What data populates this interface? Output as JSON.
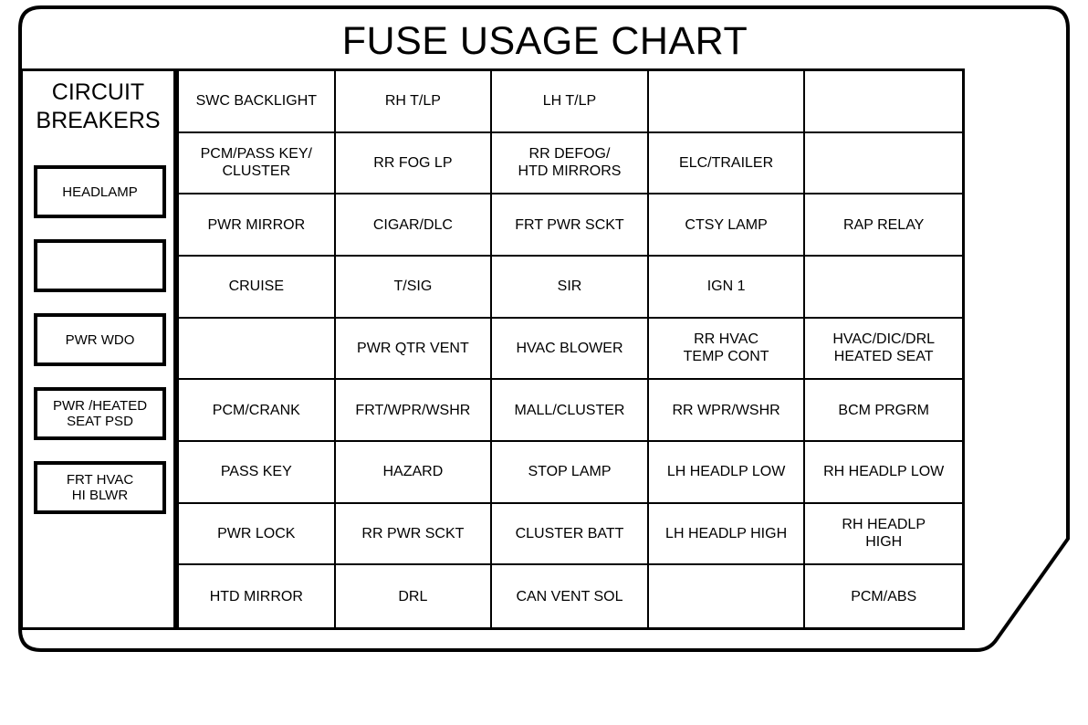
{
  "title": "FUSE USAGE CHART",
  "breakers": {
    "heading_line1": "CIRCUIT",
    "heading_line2": "BREAKERS",
    "items": [
      {
        "line1": "HEADLAMP",
        "line2": ""
      },
      {
        "line1": "",
        "line2": ""
      },
      {
        "line1": "PWR WDO",
        "line2": ""
      },
      {
        "line1": "PWR /HEATED",
        "line2": "SEAT PSD"
      },
      {
        "line1": "FRT HVAC",
        "line2": "HI BLWR"
      }
    ]
  },
  "grid": {
    "columns": 5,
    "rows": 9,
    "cells": [
      [
        {
          "line1": "SWC BACKLIGHT",
          "line2": ""
        },
        {
          "line1": "RH T/LP",
          "line2": ""
        },
        {
          "line1": "LH T/LP",
          "line2": ""
        },
        {
          "line1": "",
          "line2": ""
        },
        {
          "line1": "",
          "line2": ""
        }
      ],
      [
        {
          "line1": "PCM/PASS KEY/",
          "line2": "CLUSTER"
        },
        {
          "line1": "RR FOG LP",
          "line2": ""
        },
        {
          "line1": "RR DEFOG/",
          "line2": "HTD MIRRORS"
        },
        {
          "line1": "ELC/TRAILER",
          "line2": ""
        },
        {
          "line1": "",
          "line2": ""
        }
      ],
      [
        {
          "line1": "PWR MIRROR",
          "line2": ""
        },
        {
          "line1": "CIGAR/DLC",
          "line2": ""
        },
        {
          "line1": "FRT PWR SCKT",
          "line2": ""
        },
        {
          "line1": "CTSY LAMP",
          "line2": ""
        },
        {
          "line1": "RAP RELAY",
          "line2": ""
        }
      ],
      [
        {
          "line1": "CRUISE",
          "line2": ""
        },
        {
          "line1": "T/SIG",
          "line2": ""
        },
        {
          "line1": "SIR",
          "line2": ""
        },
        {
          "line1": "IGN 1",
          "line2": ""
        },
        {
          "line1": "",
          "line2": ""
        }
      ],
      [
        {
          "line1": "",
          "line2": ""
        },
        {
          "line1": "PWR QTR VENT",
          "line2": ""
        },
        {
          "line1": "HVAC BLOWER",
          "line2": ""
        },
        {
          "line1": "RR HVAC",
          "line2": "TEMP CONT"
        },
        {
          "line1": "HVAC/DIC/DRL",
          "line2": "HEATED SEAT"
        }
      ],
      [
        {
          "line1": "PCM/CRANK",
          "line2": ""
        },
        {
          "line1": "FRT/WPR/WSHR",
          "line2": ""
        },
        {
          "line1": "MALL/CLUSTER",
          "line2": ""
        },
        {
          "line1": "RR WPR/WSHR",
          "line2": ""
        },
        {
          "line1": "BCM PRGRM",
          "line2": ""
        }
      ],
      [
        {
          "line1": "PASS KEY",
          "line2": ""
        },
        {
          "line1": "HAZARD",
          "line2": ""
        },
        {
          "line1": "STOP LAMP",
          "line2": ""
        },
        {
          "line1": "LH HEADLP LOW",
          "line2": ""
        },
        {
          "line1": "RH HEADLP LOW",
          "line2": ""
        }
      ],
      [
        {
          "line1": "PWR LOCK",
          "line2": ""
        },
        {
          "line1": "RR PWR SCKT",
          "line2": ""
        },
        {
          "line1": "CLUSTER BATT",
          "line2": ""
        },
        {
          "line1": "LH HEADLP HIGH",
          "line2": ""
        },
        {
          "line1": "RH HEADLP",
          "line2": "HIGH"
        }
      ],
      [
        {
          "line1": "HTD MIRROR",
          "line2": ""
        },
        {
          "line1": "DRL",
          "line2": ""
        },
        {
          "line1": "CAN VENT SOL",
          "line2": ""
        },
        {
          "line1": "",
          "line2": ""
        },
        {
          "line1": "PCM/ABS",
          "line2": ""
        }
      ]
    ]
  },
  "colors": {
    "ink": "#000000",
    "paper": "#ffffff"
  }
}
